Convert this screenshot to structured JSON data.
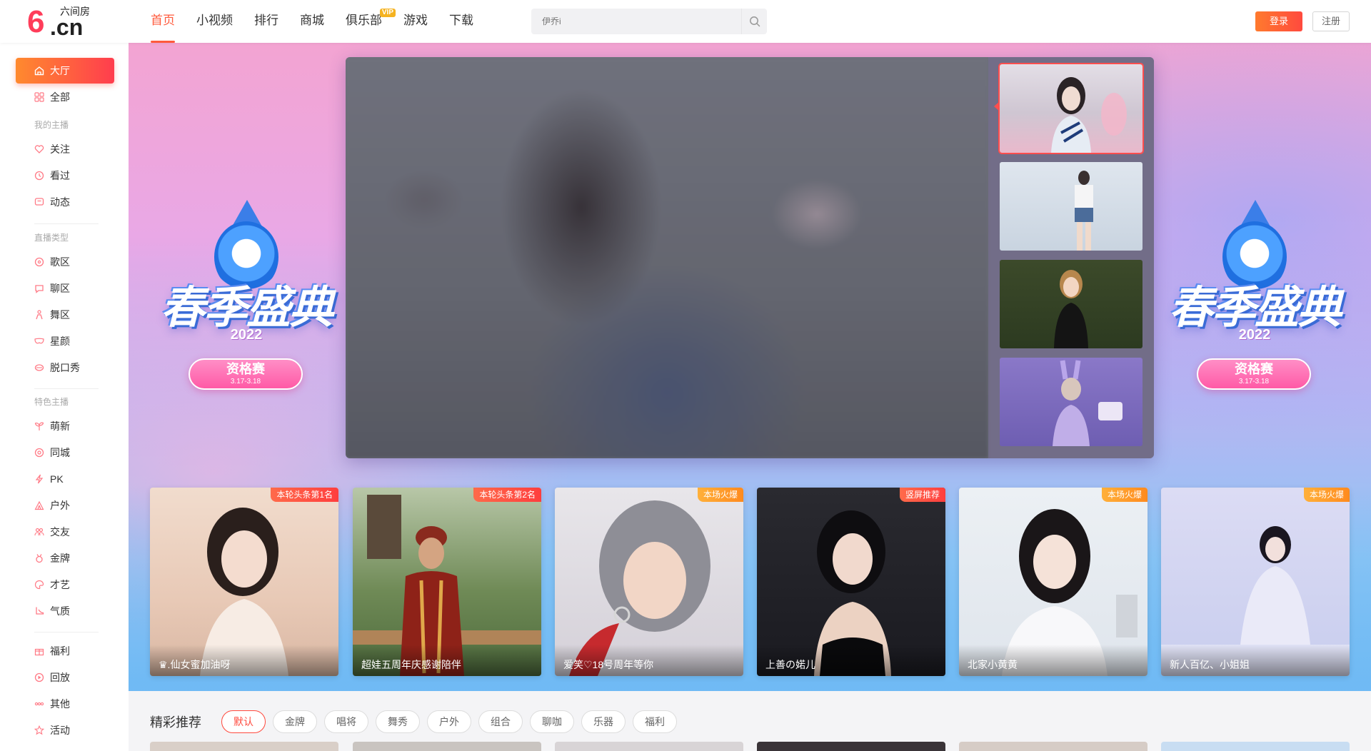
{
  "logo": {
    "brand": "六间房",
    "digit": "6",
    "domain": ".cn"
  },
  "nav": [
    {
      "label": "首页",
      "active": true
    },
    {
      "label": "小视频"
    },
    {
      "label": "排行"
    },
    {
      "label": "商城"
    },
    {
      "label": "俱乐部",
      "badge": "VIP"
    },
    {
      "label": "游戏"
    },
    {
      "label": "下载"
    }
  ],
  "search": {
    "placeholder": "伊乔i"
  },
  "auth": {
    "login": "登录",
    "register": "注册"
  },
  "sidebar": {
    "hall": "大厅",
    "all": "全部",
    "group_my": "我的主播",
    "follow": "关注",
    "watched": "看过",
    "activity": "动态",
    "group_type": "直播类型",
    "singing": "歌区",
    "chat": "聊区",
    "dance": "舞区",
    "star": "星颜",
    "talk_show": "脱口秀",
    "group_feature": "特色主播",
    "newbie": "萌新",
    "same_city": "同城",
    "pk": "PK",
    "outdoor": "户外",
    "social": "交友",
    "gold": "金牌",
    "talent": "才艺",
    "temperament": "气质",
    "welfare": "福利",
    "replay": "回放",
    "other": "其他",
    "events": "活动"
  },
  "banner": {
    "festival_title": "春季盛典",
    "festival_year": "2022",
    "pill_title": "资格赛",
    "pill_date": "3.17-3.18"
  },
  "cards": [
    {
      "tag": "本轮头条第1名",
      "tag_color": "red",
      "name": "♛.仙女蜜加油呀"
    },
    {
      "tag": "本轮头条第2名",
      "tag_color": "red",
      "name": "超娃五周年庆感谢陪伴"
    },
    {
      "tag": "本场火爆",
      "tag_color": "orange",
      "name": "爱笑♡18号周年等你"
    },
    {
      "tag": "竖屏推荐",
      "tag_color": "red",
      "name": "上善の婼儿"
    },
    {
      "tag": "本场火爆",
      "tag_color": "orange",
      "name": "北家小黄黄"
    },
    {
      "tag": "本场火爆",
      "tag_color": "orange",
      "name": "新人百亿、小姐姐"
    }
  ],
  "recommend": {
    "title": "精彩推荐",
    "chips": [
      {
        "label": "默认",
        "active": true
      },
      {
        "label": "金牌"
      },
      {
        "label": "唱将"
      },
      {
        "label": "舞秀"
      },
      {
        "label": "户外"
      },
      {
        "label": "组合"
      },
      {
        "label": "聊咖"
      },
      {
        "label": "乐器"
      },
      {
        "label": "福利"
      }
    ]
  },
  "colors": {
    "accent": "#ff4a3e",
    "accent_orange": "#ff8a2e",
    "tag_orange": "#ff8a1e",
    "vip": "#f5b321"
  }
}
